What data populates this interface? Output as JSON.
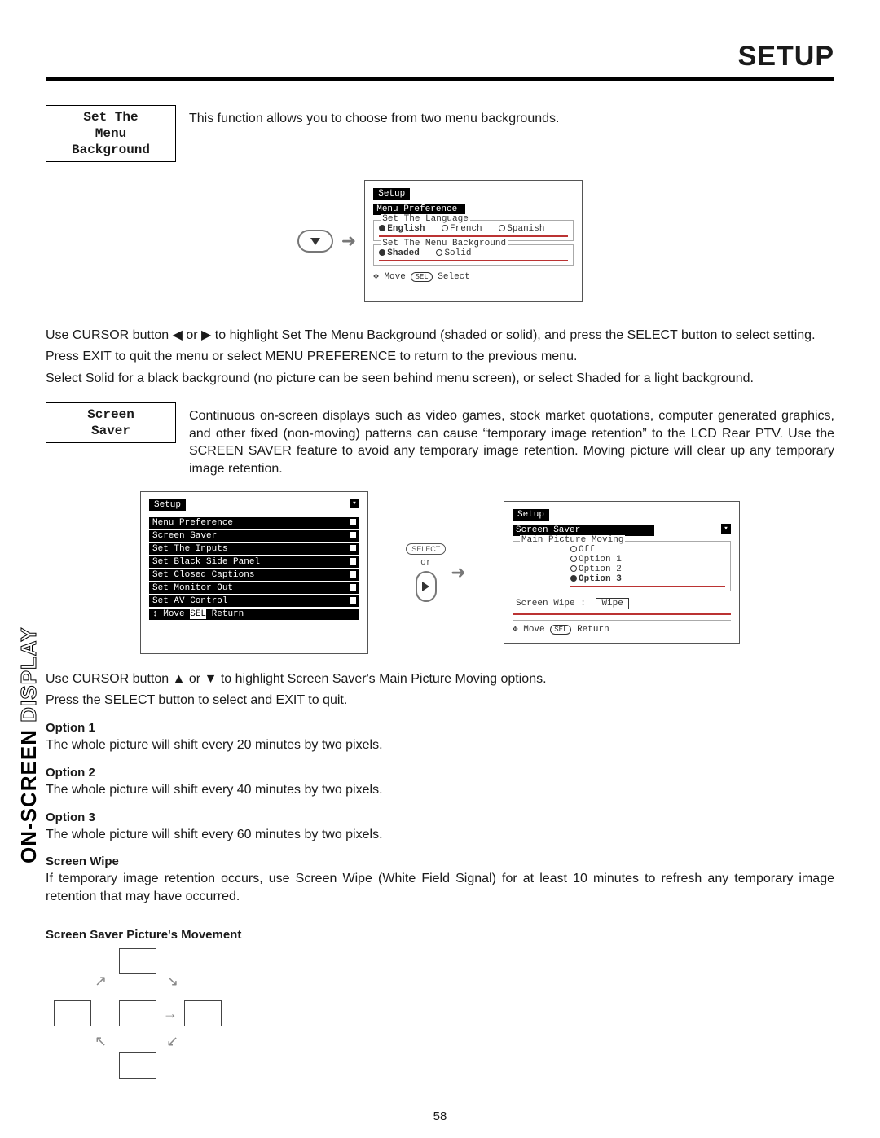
{
  "header": {
    "title": "SETUP"
  },
  "sideLabel": {
    "filled": "ON-SCREEN",
    "outline": " DISPLAY"
  },
  "pageNumber": "58",
  "section1": {
    "heading_line1": "Set The",
    "heading_line2": "Menu Background",
    "desc": "This function allows you to choose from two menu backgrounds.",
    "osd": {
      "tab": "Setup",
      "subTab": "Menu Preference",
      "group1": {
        "legend": "Set The Language",
        "opts": [
          "English",
          "French",
          "Spanish"
        ],
        "selected": 0
      },
      "group2": {
        "legend": "Set The Menu Background",
        "opts": [
          "Shaded",
          "Solid"
        ],
        "selected": 0
      },
      "hint_move": "Move",
      "hint_sel": "SEL",
      "hint_select": "Select"
    },
    "body1": "Use CURSOR button ◀ or ▶ to highlight Set The Menu Background (shaded or solid), and press the SELECT button to select setting.",
    "body2": "Press EXIT to quit the menu or select MENU PREFERENCE to return to the previous menu.",
    "body3": "Select Solid for a black background (no picture can be seen behind menu screen), or select Shaded for a light background."
  },
  "section2": {
    "heading_line1": "Screen",
    "heading_line2": "Saver",
    "desc": "Continuous on-screen displays such as video games, stock market quotations, computer generated graphics, and other fixed (non-moving) patterns can cause “temporary image retention” to the LCD Rear PTV.  Use the SCREEN SAVER feature to avoid any temporary image retention.  Moving picture will clear up any temporary image retention.",
    "osdLeft": {
      "tab": "Setup",
      "rows": [
        "Menu Preference",
        "Screen Saver",
        "Set The Inputs",
        "Set Black Side Panel",
        "Set Closed Captions",
        "Set Monitor Out",
        "Set AV Control"
      ],
      "hint_move": "Move",
      "hint_sel": "SEL",
      "hint_ret": "Return"
    },
    "mid": {
      "select": "SELECT",
      "or": "or"
    },
    "osdRight": {
      "tab": "Setup",
      "subTab": "Screen Saver",
      "groupLegend": "Main Picture Moving",
      "opts": [
        "Off",
        "Option 1",
        "Option 2",
        "Option 3"
      ],
      "selected": 3,
      "wipeLabel": "Screen Wipe :",
      "wipeBtn": "Wipe",
      "hint_move": "Move",
      "hint_sel": "SEL",
      "hint_ret": "Return"
    },
    "body1": "Use CURSOR button ▲ or ▼ to highlight Screen Saver's Main Picture Moving options.",
    "body2": "Press the SELECT button to select and EXIT to quit.",
    "options": [
      {
        "title": "Option 1",
        "desc": "The whole picture will shift every 20 minutes by two pixels."
      },
      {
        "title": "Option 2",
        "desc": "The whole picture will shift every 40 minutes by two pixels."
      },
      {
        "title": "Option 3",
        "desc": "The whole picture will shift every 60 minutes by two pixels."
      }
    ],
    "wipe": {
      "title": "Screen Wipe",
      "desc": "If temporary image retention occurs, use Screen Wipe (White Field Signal) for at least 10 minutes to refresh any temporary image retention that may have occurred."
    },
    "movementTitle": "Screen Saver Picture's Movement"
  }
}
